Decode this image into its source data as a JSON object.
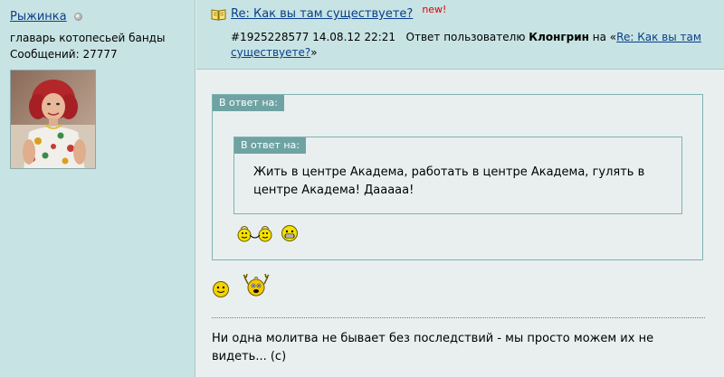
{
  "author": {
    "name": "Рыжинка",
    "title": "главарь котопесьей банды",
    "posts_label": "Сообщений: 27777"
  },
  "post": {
    "title": "Re: Как вы там существуете?",
    "new_badge": "new!",
    "meta_id_date": "#1925228577 14.08.12 22:21",
    "reply_prefix": "Ответ пользователю",
    "reply_to_user": "Клонгрин",
    "reply_on": "на «",
    "reply_link": "Re: Как вы там существуете?",
    "reply_suffix": "»"
  },
  "quote_outer": {
    "label": "В ответ на:"
  },
  "quote_inner": {
    "label": "В ответ на:",
    "text": "Жить в центре Академа, работать в центре Академа, гулять в центре Академа! Дааааа!"
  },
  "signature": "Ни одна молитва не бывает без последствий - мы просто можем их не видеть... (с)",
  "icons": {
    "status": "status-offline-icon",
    "title": "book-icon",
    "smileys": [
      "jump-rope-smiley-icon",
      "grin-smiley-icon",
      "smile-smiley-icon",
      "hands-up-smiley-icon"
    ]
  },
  "colors": {
    "link": "#0a3f8a",
    "new_badge": "#e00000",
    "header_bg": "#c8e3e3",
    "body_bg": "#e9efef",
    "quote_border": "#7fb2b2",
    "quote_label_bg": "#6fa3a3"
  }
}
